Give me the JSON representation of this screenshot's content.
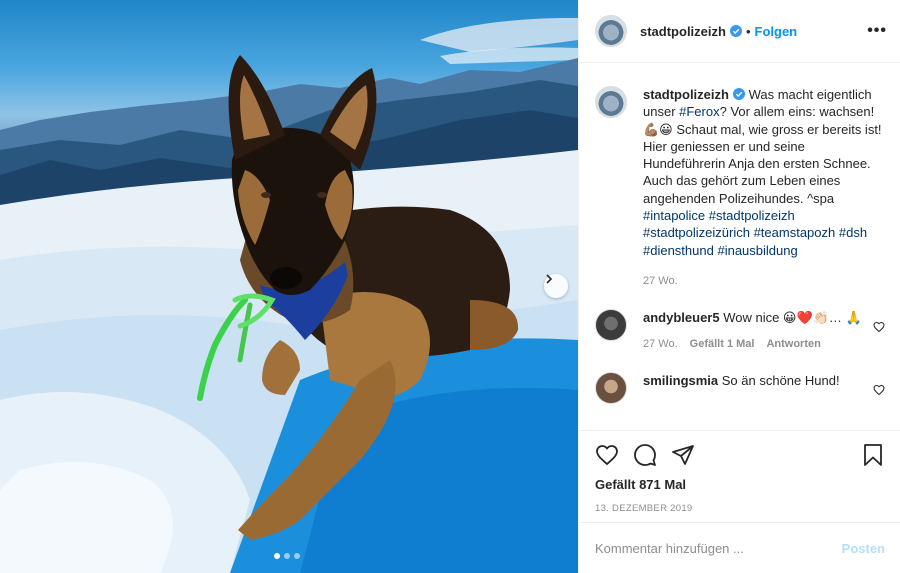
{
  "post": {
    "username": "stadtpolizeizh",
    "follow_label": "Folgen",
    "separator": "•",
    "more_label": "•••",
    "caption_parts": {
      "p1": " Was macht eigentlich unser ",
      "tag_ferox": "#Ferox",
      "p2": "? Vor allem eins: wachsen! 💪🏽😀 Schaut mal, wie gross er bereits ist! Hier geniessen er und seine Hundeführerin Anja den ersten Schnee. Auch das gehört zum Leben eines angehenden Polizeihundes. ^spa",
      "hashtags": [
        "#intapolice",
        "#stadtpolizeizh",
        "#stadtpolizeizürich",
        "#teamstapozh",
        "#dsh",
        "#diensthund",
        "#inausbildung"
      ]
    },
    "caption_age": "27 Wo.",
    "likes": "Gefällt 871 Mal",
    "date": "13. DEZEMBER 2019"
  },
  "comments": [
    {
      "username": "andybleuer5",
      "text": " Wow nice 😀❤️👏🏻… 🙏",
      "age": "27 Wo.",
      "likes": "Gefällt 1 Mal",
      "reply_label": "Antworten"
    },
    {
      "username": "smilingsmia",
      "text": " So än schöne Hund!"
    }
  ],
  "add_comment": {
    "placeholder": "Kommentar hinzufügen ...",
    "post_label": "Posten"
  },
  "carousel": {
    "slide_count": 3,
    "active_index": 0
  },
  "icons": {
    "heart": "heart-icon",
    "comment": "comment-icon",
    "share": "share-icon",
    "save": "bookmark-icon",
    "verified": "verified-badge-icon",
    "next": "chevron-right-icon"
  },
  "colors": {
    "link": "#00376b",
    "accent": "#0095f6",
    "muted": "#8e8e8e"
  }
}
